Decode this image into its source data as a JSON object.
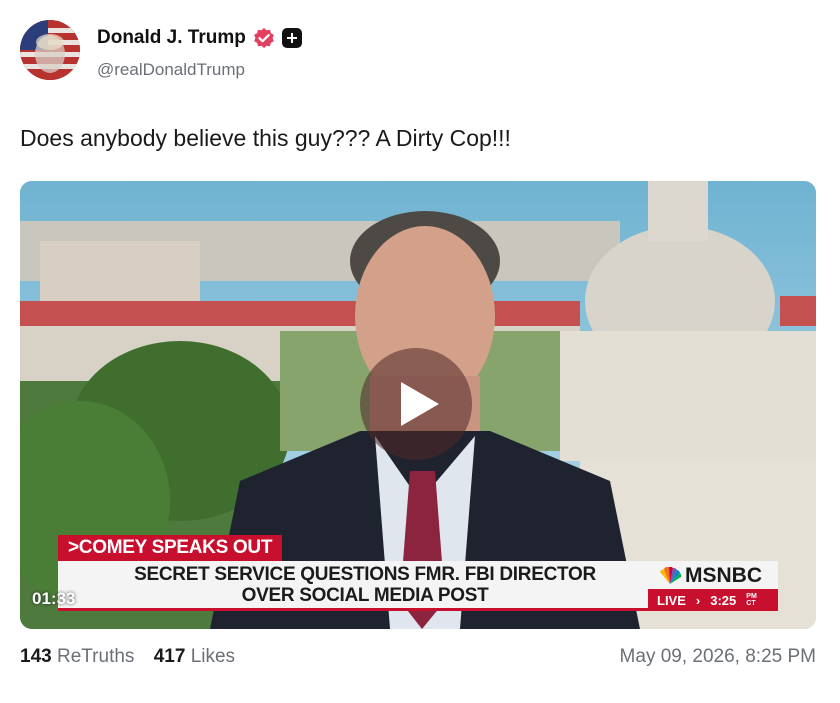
{
  "author": {
    "display_name": "Donald J. Trump",
    "handle": "@realDonaldTrump",
    "verified_color": "#e2405f"
  },
  "post": {
    "text": "Does anybody believe this guy??? A Dirty Cop!!!"
  },
  "video": {
    "chyron_tag": ">COMEY SPEAKS OUT",
    "chyron_line1": "SECRET SERVICE QUESTIONS FMR. FBI DIRECTOR",
    "chyron_line2": "OVER SOCIAL MEDIA POST",
    "network": "MSNBC",
    "live_label": "LIVE",
    "live_arrow": "›",
    "live_time": "3:25",
    "live_time_zone_top": "PM",
    "live_time_zone_bottom": "CT",
    "duration": "01:33",
    "play_icon": "play-icon"
  },
  "stats": {
    "retruths_count": "143",
    "retruths_label": "ReTruths",
    "likes_count": "417",
    "likes_label": "Likes",
    "timestamp": "May 09, 2026, 8:25 PM"
  },
  "colors": {
    "accent_red": "#c8102e",
    "muted_text": "#6b6f76"
  }
}
